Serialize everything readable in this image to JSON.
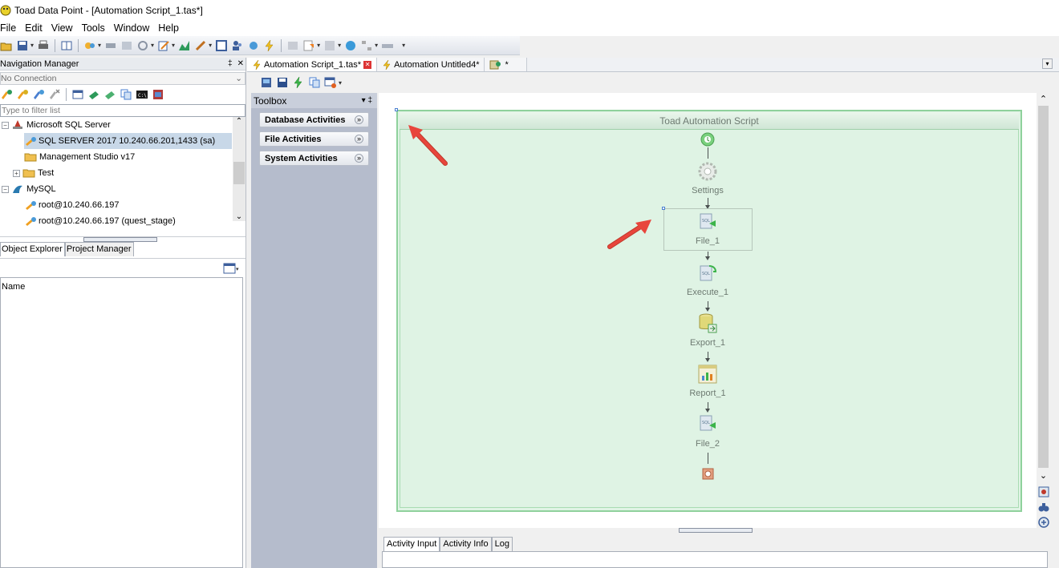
{
  "window": {
    "title": "Toad Data Point - [Automation Script_1.tas*]"
  },
  "menu": [
    "File",
    "Edit",
    "View",
    "Tools",
    "Window",
    "Help"
  ],
  "nav_manager": {
    "title": "Navigation Manager",
    "pin": "‡",
    "close": "✕",
    "connection": "No Connection",
    "filter_placeholder": "Type to filter list",
    "tree": [
      {
        "label": "Microsoft SQL Server",
        "expander": "−"
      },
      {
        "label": "SQL SERVER 2017 10.240.66.201,1433 (sa)"
      },
      {
        "label": "Management Studio v17"
      },
      {
        "label": "Test",
        "expander": "+"
      },
      {
        "label": "MySQL",
        "expander": "−"
      },
      {
        "label": "root@10.240.66.197"
      },
      {
        "label": "root@10.240.66.197 (quest_stage)"
      }
    ]
  },
  "object_tabs": [
    "Object Explorer",
    "Project Manager"
  ],
  "object_list": {
    "column": "Name"
  },
  "doc_tabs": [
    {
      "label": "Automation Script_1.tas*"
    },
    {
      "label": "Automation Untitled4*"
    },
    {
      "label": "*"
    }
  ],
  "toolbox": {
    "title": "Toolbox",
    "controls": "▾ ‡",
    "groups": [
      "Database Activities",
      "File Activities",
      "System Activities"
    ]
  },
  "workflow": {
    "title": "Toad Automation Script",
    "steps": [
      "Settings",
      "File_1",
      "Execute_1",
      "Export_1",
      "Report_1",
      "File_2"
    ]
  },
  "bottom_tabs": [
    "Activity Input",
    "Activity Info",
    "Log"
  ],
  "colors": {
    "canvas_green": "#dff3e4",
    "toolbox_bg": "#b5bccc",
    "annotation_red": "#e8453c"
  }
}
